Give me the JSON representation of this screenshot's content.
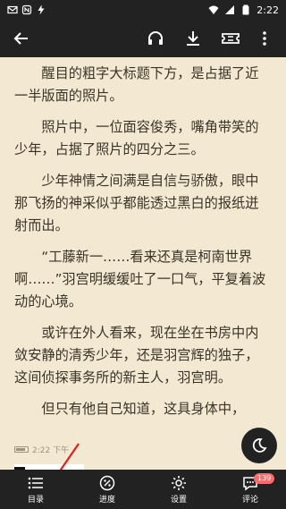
{
  "status_bar": {
    "time": "2:22",
    "left_icons": [
      "email-icon",
      "nfc-icon",
      "lightning-icon"
    ],
    "right_icons": [
      "wifi-icon",
      "signal-icon",
      "battery-icon"
    ]
  },
  "toolbar": {
    "icons": [
      "back-icon",
      "headphones-icon",
      "download-icon",
      "ticket-icon",
      "more-icon"
    ]
  },
  "content": {
    "paragraphs": [
      "醒目的粗字大标题下方，是占据了近一半版面的照片。",
      "照片中，一位面容俊秀，嘴角带笑的少年，占据了照片的四分之三。",
      "少年神情之间满是自信与骄傲，眼中那飞扬的神采似乎都能透过黑白的报纸迸射而出。",
      "“工藤新一……看来还真是柯南世界啊……”羽宫明缓缓吐了一口气，平复着波动的心境。",
      "或许在外人看来，现在坐在书房中内敛安静的清秀少年，还是羽宫辉的独子，这间侦探事务所的新主人，羽宫明。",
      "但只有他自己知道，这具身体中，"
    ]
  },
  "reader_status": {
    "time": "2:22 下午"
  },
  "bottom_nav": {
    "items": [
      {
        "label": "目录",
        "icon": "list-icon"
      },
      {
        "label": "进度",
        "icon": "percent-icon"
      },
      {
        "label": "设置",
        "icon": "settings-icon"
      },
      {
        "label": "评论",
        "icon": "comment-icon",
        "badge": "139"
      }
    ]
  },
  "colors": {
    "background": "#f3e9d2",
    "text": "#3b3227",
    "bars": "#222222",
    "badge": "#ff6b6b",
    "annotation_arrow": "#e02020"
  }
}
